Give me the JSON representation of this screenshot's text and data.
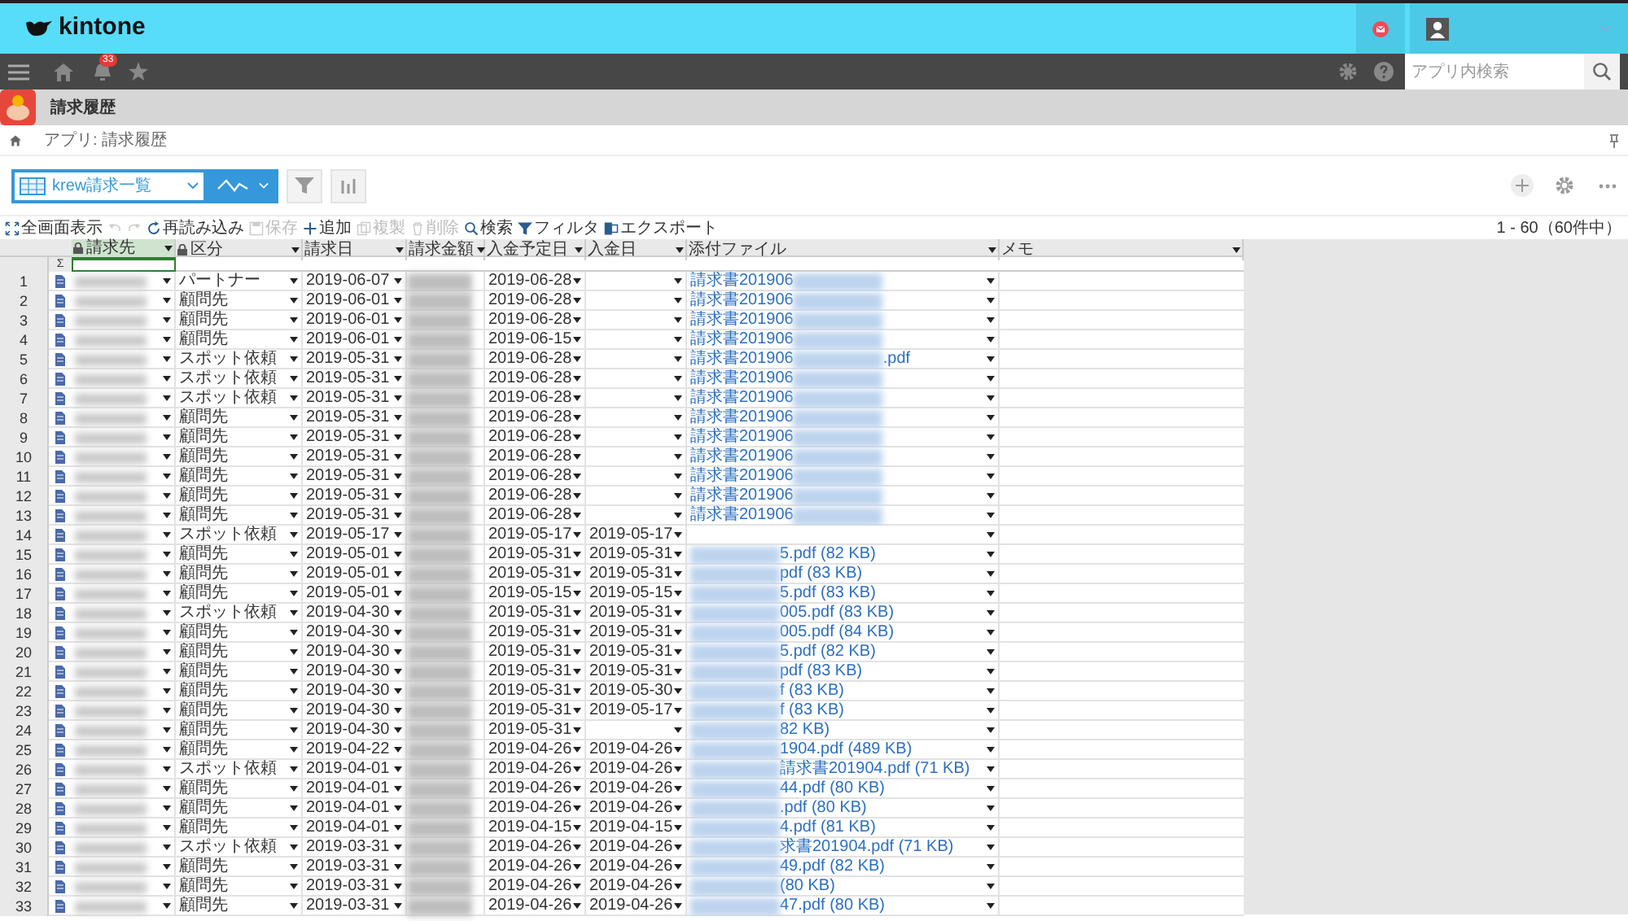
{
  "header": {
    "logo": "kintone"
  },
  "nav": {
    "notification_count": "33",
    "search": {
      "placeholder": "アプリ内検索"
    }
  },
  "app": {
    "title": "請求履歴"
  },
  "breadcrumb": {
    "path": "アプリ: 請求履歴"
  },
  "view": {
    "name": "krew請求一覧"
  },
  "toolbar": [
    {
      "kind": "fullscreen",
      "label": "全画面表示",
      "disabled": false
    },
    {
      "kind": "undo",
      "disabled": true
    },
    {
      "kind": "redo",
      "disabled": true
    },
    {
      "kind": "reload",
      "label": "再読み込み",
      "disabled": false
    },
    {
      "kind": "save",
      "label": "保存",
      "disabled": true
    },
    {
      "kind": "add",
      "label": "追加",
      "disabled": false
    },
    {
      "kind": "copy",
      "label": "複製",
      "disabled": true
    },
    {
      "kind": "delete",
      "label": "削除",
      "disabled": true
    },
    {
      "kind": "search",
      "label": "検索",
      "disabled": false
    },
    {
      "kind": "filter",
      "label": "フィルタ",
      "disabled": false
    },
    {
      "kind": "export",
      "label": "エクスポート",
      "disabled": false
    }
  ],
  "record_count": "1 - 60（60件中）",
  "table": {
    "sum_mark": "Σ",
    "columns": [
      {
        "label": "請求先",
        "locked": true,
        "selected": true
      },
      {
        "label": "区分",
        "locked": true,
        "selected": false
      },
      {
        "label": "請求日",
        "locked": false,
        "selected": false
      },
      {
        "label": "請求金額",
        "locked": false,
        "selected": false
      },
      {
        "label": "入金予定日",
        "locked": false,
        "selected": false
      },
      {
        "label": "入金日",
        "locked": false,
        "selected": false
      },
      {
        "label": "添付ファイル",
        "locked": false,
        "selected": false
      },
      {
        "label": "メモ",
        "locked": false,
        "selected": false
      }
    ],
    "rows": [
      {
        "no": "1",
        "category": "パートナー",
        "billed": "2019-06-07",
        "due": "2019-06-28",
        "file_prefix": "請求書201906"
      },
      {
        "no": "2",
        "category": "顧問先",
        "billed": "2019-06-01",
        "due": "2019-06-28",
        "file_prefix": "請求書201906"
      },
      {
        "no": "3",
        "category": "顧問先",
        "billed": "2019-06-01",
        "due": "2019-06-28",
        "file_prefix": "請求書201906"
      },
      {
        "no": "4",
        "category": "顧問先",
        "billed": "2019-06-01",
        "due": "2019-06-15",
        "file_prefix": "請求書201906"
      },
      {
        "no": "5",
        "category": "スポット依頼",
        "billed": "2019-05-31",
        "due": "2019-06-28",
        "file_prefix": "請求書201906",
        "file_suffix": ".pdf"
      },
      {
        "no": "6",
        "category": "スポット依頼",
        "billed": "2019-05-31",
        "due": "2019-06-28",
        "file_prefix": "請求書201906"
      },
      {
        "no": "7",
        "category": "スポット依頼",
        "billed": "2019-05-31",
        "due": "2019-06-28",
        "file_prefix": "請求書201906"
      },
      {
        "no": "8",
        "category": "顧問先",
        "billed": "2019-05-31",
        "due": "2019-06-28",
        "file_prefix": "請求書201906"
      },
      {
        "no": "9",
        "category": "顧問先",
        "billed": "2019-05-31",
        "due": "2019-06-28",
        "file_prefix": "請求書201906"
      },
      {
        "no": "10",
        "category": "顧問先",
        "billed": "2019-05-31",
        "due": "2019-06-28",
        "file_prefix": "請求書201906"
      },
      {
        "no": "11",
        "category": "顧問先",
        "billed": "2019-05-31",
        "due": "2019-06-28",
        "file_prefix": "請求書201906"
      },
      {
        "no": "12",
        "category": "顧問先",
        "billed": "2019-05-31",
        "due": "2019-06-28",
        "file_prefix": "請求書201906"
      },
      {
        "no": "13",
        "category": "顧問先",
        "billed": "2019-05-31",
        "due": "2019-06-28",
        "file_prefix": "請求書201906"
      },
      {
        "no": "14",
        "category": "スポット依頼",
        "billed": "2019-05-17",
        "due": "2019-05-17",
        "paid": "2019-05-17"
      },
      {
        "no": "15",
        "category": "顧問先",
        "billed": "2019-05-01",
        "due": "2019-05-31",
        "paid": "2019-05-31",
        "file_suffix": "5.pdf (82 KB)"
      },
      {
        "no": "16",
        "category": "顧問先",
        "billed": "2019-05-01",
        "due": "2019-05-31",
        "paid": "2019-05-31",
        "file_suffix": "pdf (83 KB)"
      },
      {
        "no": "17",
        "category": "顧問先",
        "billed": "2019-05-01",
        "due": "2019-05-15",
        "paid": "2019-05-15",
        "file_suffix": "5.pdf (83 KB)"
      },
      {
        "no": "18",
        "category": "スポット依頼",
        "billed": "2019-04-30",
        "due": "2019-05-31",
        "paid": "2019-05-31",
        "file_suffix": "005.pdf (83 KB)"
      },
      {
        "no": "19",
        "category": "顧問先",
        "billed": "2019-04-30",
        "due": "2019-05-31",
        "paid": "2019-05-31",
        "file_suffix": "005.pdf (84 KB)"
      },
      {
        "no": "20",
        "category": "顧問先",
        "billed": "2019-04-30",
        "due": "2019-05-31",
        "paid": "2019-05-31",
        "file_suffix": "5.pdf (82 KB)"
      },
      {
        "no": "21",
        "category": "顧問先",
        "billed": "2019-04-30",
        "due": "2019-05-31",
        "paid": "2019-05-31",
        "file_suffix": "pdf (83 KB)"
      },
      {
        "no": "22",
        "category": "顧問先",
        "billed": "2019-04-30",
        "due": "2019-05-31",
        "paid": "2019-05-30",
        "file_suffix": "f (83 KB)"
      },
      {
        "no": "23",
        "category": "顧問先",
        "billed": "2019-04-30",
        "due": "2019-05-31",
        "paid": "2019-05-17",
        "file_suffix": "f (83 KB)"
      },
      {
        "no": "24",
        "category": "顧問先",
        "billed": "2019-04-30",
        "due": "2019-05-31",
        "file_suffix": "82 KB)"
      },
      {
        "no": "25",
        "category": "顧問先",
        "billed": "2019-04-22",
        "due": "2019-04-26",
        "paid": "2019-04-26",
        "file_suffix": "1904.pdf (489 KB)"
      },
      {
        "no": "26",
        "category": "スポット依頼",
        "billed": "2019-04-01",
        "due": "2019-04-26",
        "paid": "2019-04-26",
        "file_suffix": "請求書201904.pdf (71 KB)"
      },
      {
        "no": "27",
        "category": "顧問先",
        "billed": "2019-04-01",
        "due": "2019-04-26",
        "paid": "2019-04-26",
        "file_suffix": "44.pdf (80 KB)"
      },
      {
        "no": "28",
        "category": "顧問先",
        "billed": "2019-04-01",
        "due": "2019-04-26",
        "paid": "2019-04-26",
        "file_suffix": ".pdf (80 KB)"
      },
      {
        "no": "29",
        "category": "顧問先",
        "billed": "2019-04-01",
        "due": "2019-04-15",
        "paid": "2019-04-15",
        "file_suffix": "4.pdf (81 KB)"
      },
      {
        "no": "30",
        "category": "スポット依頼",
        "billed": "2019-03-31",
        "due": "2019-04-26",
        "paid": "2019-04-26",
        "file_suffix": "求書201904.pdf (71 KB)"
      },
      {
        "no": "31",
        "category": "顧問先",
        "billed": "2019-03-31",
        "due": "2019-04-26",
        "paid": "2019-04-26",
        "file_suffix": "49.pdf (82 KB)"
      },
      {
        "no": "32",
        "category": "顧問先",
        "billed": "2019-03-31",
        "due": "2019-04-26",
        "paid": "2019-04-26",
        "file_suffix": "(80 KB)"
      },
      {
        "no": "33",
        "category": "顧問先",
        "billed": "2019-03-31",
        "due": "2019-04-26",
        "paid": "2019-04-26",
        "file_suffix": "47.pdf (80 KB)"
      }
    ]
  }
}
